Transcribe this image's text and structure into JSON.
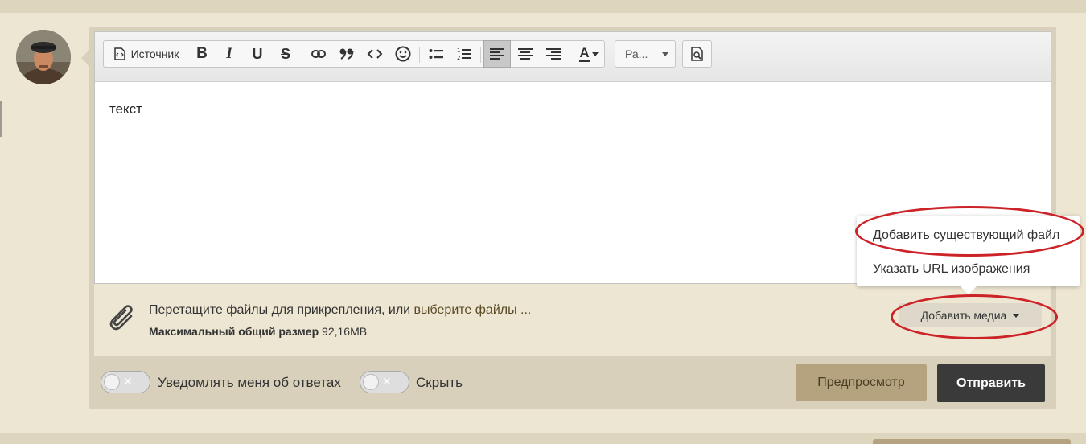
{
  "toolbar": {
    "source_label": "Источник",
    "bold": "B",
    "italic": "I",
    "underline": "U",
    "strike": "S",
    "font_size_label": "Ра...",
    "text_color_letter": "A",
    "icons": [
      "source-icon",
      "bold-icon",
      "italic-icon",
      "underline-icon",
      "strikethrough-icon",
      "link-icon",
      "quote-icon",
      "code-icon",
      "smiley-icon",
      "bullet-list-icon",
      "numbered-list-icon",
      "align-left-icon",
      "align-center-icon",
      "align-right-icon",
      "text-color-icon",
      "font-size-dropdown",
      "preview-icon"
    ]
  },
  "editor": {
    "content": "текст"
  },
  "attach": {
    "text": "Перетащите файлы для прикрепления, или ",
    "link": "выберите файлы ...",
    "max_label": "Максимальный общий размер",
    "max_value": "92,16MB"
  },
  "media": {
    "button": "Добавить медиа",
    "menu": [
      "Добавить существующий файл",
      "Указать URL изображения"
    ]
  },
  "options": {
    "notify_label": "Уведомлять меня об ответах",
    "hide_label": "Скрыть"
  },
  "actions": {
    "preview": "Предпросмотр",
    "send": "Отправить"
  },
  "colors": {
    "page_bg": "#ede6d2",
    "panel_bg": "#d8d0bb",
    "preview_btn": "#b5a27f",
    "send_btn": "#3a3a3a",
    "highlight": "#cc2328"
  }
}
